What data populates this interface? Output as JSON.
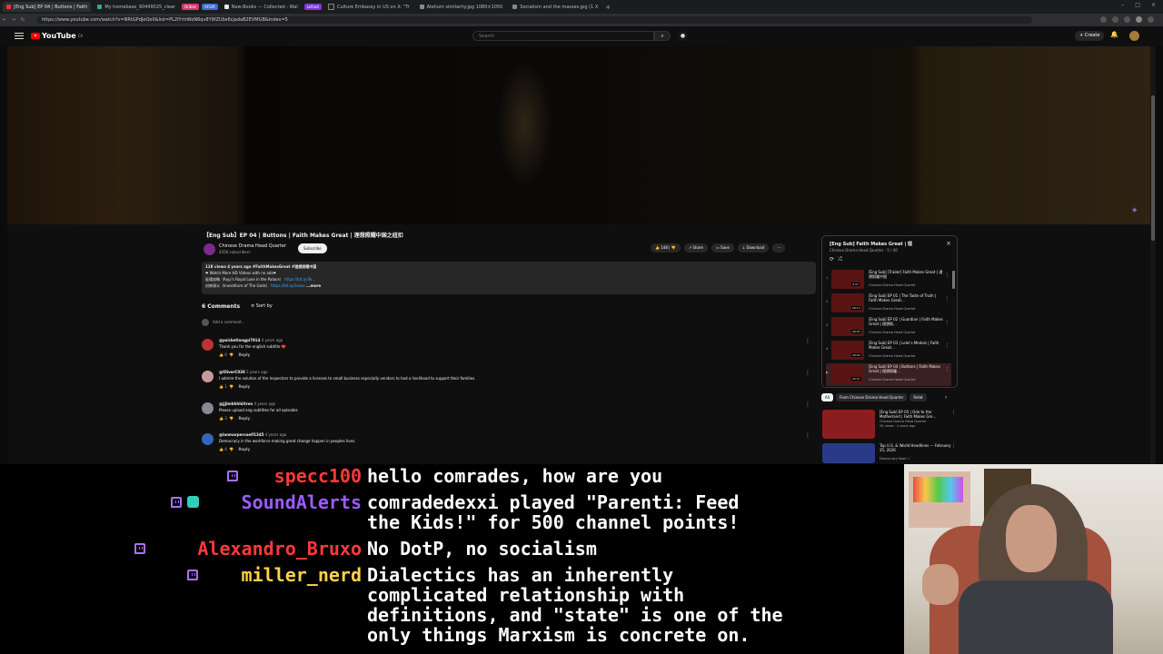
{
  "browser": {
    "tabs": [
      {
        "label": "[Eng Sub] EP 04 | Buttons | Faith",
        "active": true
      },
      {
        "label": "My homebase_90449025_clear",
        "active": false
      },
      {
        "label": "New-Books — Collected - Wal",
        "active": false
      },
      {
        "label": "Culture Embassy in US on X: \"Tr",
        "active": false
      },
      {
        "label": "Atelium similarity.jpg 1080×1050",
        "active": false
      },
      {
        "label": "Socialism and the masses.jpg (1 X",
        "active": false
      }
    ],
    "pills": [
      {
        "label": "Dribes",
        "color": "#d23b6b"
      },
      {
        "label": "AFGM",
        "color": "#3b6bd2"
      },
      {
        "label": "LeFoot",
        "color": "#7b3bd2"
      }
    ],
    "url": "https://www.youtube.com/watch?v=NRtGPdJeQe0&list=PL2IYrtrWoN6qv8Y9fZUbs6cjadaB2EVMGB&index=5"
  },
  "youtube": {
    "logo": "YouTube",
    "region": "CA",
    "search_placeholder": "Search",
    "create_label": "Create",
    "video_title": "【Eng Sub】EP 04 | Buttons | Faith Makes Great | 理想照耀中国之纽扣",
    "channel_name": "Chinese Drama Head Quarter",
    "channel_subs": "435K subscribers",
    "subscribe_label": "Subscribe",
    "actions": {
      "like": "148",
      "share": "Share",
      "save": "Save",
      "download": "Download"
    },
    "description": {
      "meta": "11K views  4 years ago  #FaithMakesGreat #理想照耀中国",
      "line1": "❤ Watch More HD Videos with no ads❤",
      "line2_label": "延禧攻略（Ruyi's Royal Love in the Palace）",
      "line2_link": "https://bit.ly/3k…",
      "line3_label": "封神演义（Investiture of The Gods）",
      "line3_link": "https://bit.ly/2xxxx",
      "more": "...more"
    },
    "comments_count": "6 Comments",
    "sort_by": "Sort by",
    "add_comment": "Add a comment...",
    "comments": [
      {
        "handle": "@psicketlongpi7914",
        "time": "4 years ago",
        "text": "Thank you for the english subtitle ❤️",
        "likes": "6",
        "reply": "Reply",
        "color": "#b33"
      },
      {
        "handle": "@OliverC038",
        "time": "3 years ago",
        "text": "I admire the solution of the Inspectors to provide a licenses to small business especially vendors to had a livelihood to support their families.",
        "likes": "1",
        "reply": "Reply",
        "color": "#c99"
      },
      {
        "handle": "@jjjlmhhhhiitren",
        "time": "4 years ago",
        "text": "Please upload eng subtitles for all episodes",
        "likes": "3",
        "reply": "Reply",
        "color": "#889"
      },
      {
        "handle": "@lanmarpercoelf1345",
        "time": "4 years ago",
        "text": "Democracy in the workforce making great change happen in peoples lives.",
        "likes": "4",
        "reply": "Reply",
        "color": "#36b"
      }
    ],
    "playlist": {
      "title": "[Eng Sub] Faith Makes Great | 理",
      "subtitle": "Chinese Drama Head Quarter - 5 / 40",
      "items": [
        {
          "num": "1",
          "title": "[Eng Sub] [Trailer] Faith Makes Great | 理想照耀中国",
          "channel": "Chinese Drama Head Quarter",
          "duration": "4:47",
          "current": false
        },
        {
          "num": "2",
          "title": "[Eng Sub] EP 01 | The Taste of Truth | Faith Makes Great...",
          "channel": "Chinese Drama Head Quarter",
          "duration": "28:13",
          "current": false
        },
        {
          "num": "3",
          "title": "[Eng Sub] EP 02 | Guardian | Faith Makes Great | 理想照...",
          "channel": "Chinese Drama Head Quarter",
          "duration": "26:03",
          "current": false
        },
        {
          "num": "4",
          "title": "[Eng Sub] EP 03 | Lelei's Medals | Faith Makes Great...",
          "channel": "Chinese Drama Head Quarter",
          "duration": "29:04",
          "current": false
        },
        {
          "num": "▶",
          "title": "[Eng Sub] EP 04 | Buttons | Faith Makes Great | 理想照耀...",
          "channel": "Chinese Drama Head Quarter",
          "duration": "25:27",
          "current": true
        }
      ]
    },
    "chips": [
      "All",
      "From Chinese Drama Head Quarter",
      "Relat"
    ],
    "recommendations": [
      {
        "title": "[Eng Sub] EP 05 | Ode to the Motherland | Faith Makes Gre...",
        "channel": "Chinese Drama Head Quarter",
        "views": "2K views · 4 years ago",
        "badge": "05",
        "duration": "30:34"
      },
      {
        "title": "Top U.S. & World Headlines — February 25, 2026",
        "channel": "Democracy Now! ✓",
        "views": "",
        "badge": "",
        "duration": ""
      }
    ]
  },
  "chat": [
    {
      "user": "specc100",
      "user_color": "#ff3a3a",
      "msg_lines": [
        "hello comrades, how are you"
      ],
      "icons": [
        "twitch-icon"
      ]
    },
    {
      "user": "SoundAlerts",
      "user_color": "#9b5cff",
      "msg_lines": [
        "comradedexxi played \"Parenti: Feed",
        "the Kids!\" for 500 channel points!"
      ],
      "icons": [
        "twitch-icon",
        "soundalerts-icon"
      ]
    },
    {
      "user": "Alexandro_Bruxo",
      "user_color": "#ff3a3a",
      "msg_lines": [
        "No DotP, no socialism"
      ],
      "icons": [
        "twitch-icon"
      ]
    },
    {
      "user": "miller_nerd",
      "user_color": "#ffd24a",
      "msg_lines": [
        "Dialectics has an inherently",
        "complicated relationship with",
        "definitions, and \"state\" is one of the",
        "only things Marxism is concrete on."
      ],
      "icons": [
        "twitch-icon"
      ]
    }
  ]
}
